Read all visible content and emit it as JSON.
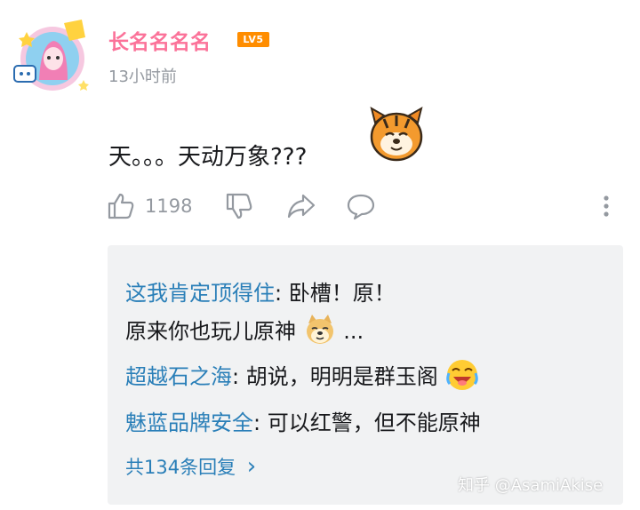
{
  "comment": {
    "username": "长名名名名",
    "level_badge": "LV5",
    "time": "13小时前",
    "text": "天。。。天动万象???",
    "like_count": "1198",
    "emoji_icon": "tiger-face-emoji"
  },
  "replies": {
    "items": [
      {
        "author": "这我肯定顶得住",
        "sep": ": ",
        "line1": "卧槽！原！",
        "line2": "原来你也玩儿原神",
        "line2_tail": "...",
        "emoji": "doge-emoji"
      },
      {
        "author": "超越石之海",
        "sep": ": ",
        "text": "胡说，明明是群玉阁",
        "emoji": "laugh-cry-emoji"
      },
      {
        "author": "魅蓝品牌安全",
        "sep": ": ",
        "text": "可以红警，但不能原神"
      }
    ],
    "more_label": "共134条回复",
    "more_arrow": "›"
  },
  "watermark": "知乎 @AsamiAkise",
  "colors": {
    "username": "#fb7299",
    "link": "#2a7fb8",
    "meta": "#9499a0",
    "reply_bg": "#f1f2f3",
    "level_badge": "#ff8d00"
  }
}
